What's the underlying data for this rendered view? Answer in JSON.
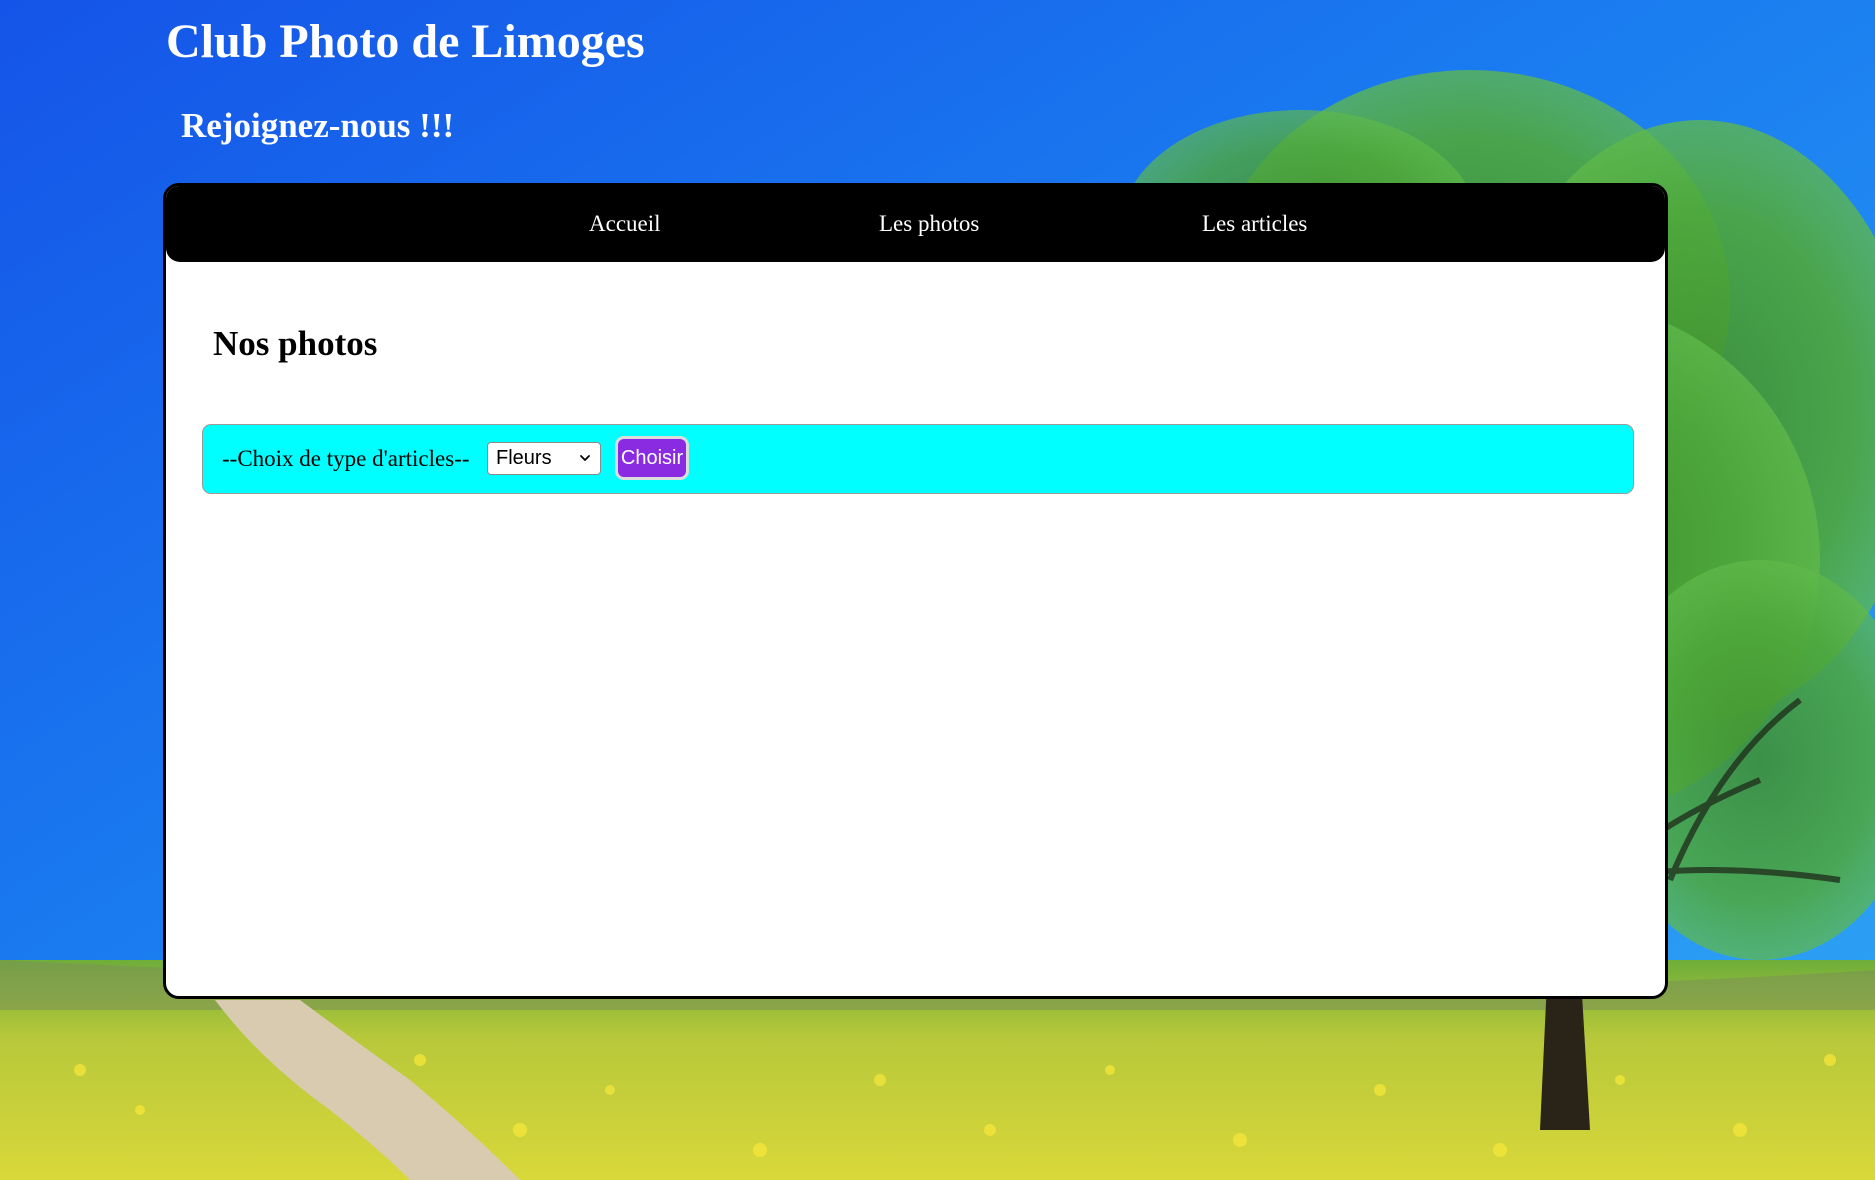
{
  "header": {
    "title": "Club Photo de Limoges",
    "subtitle": "Rejoignez-nous !!!"
  },
  "nav": {
    "items": [
      {
        "label": "Accueil"
      },
      {
        "label": "Les photos"
      },
      {
        "label": "Les articles"
      }
    ]
  },
  "main": {
    "heading": "Nos photos",
    "filter": {
      "label": "--Choix de type d'articles--",
      "select_value": "Fleurs",
      "button_label": "Choisir"
    }
  },
  "colors": {
    "nav_background": "#000000",
    "filter_background": "#00ffff",
    "button_background": "#8a2be2",
    "panel_background": "#ffffff",
    "text_header": "#ffffff"
  },
  "icons": {
    "select_arrow": "chevron-down-icon"
  }
}
